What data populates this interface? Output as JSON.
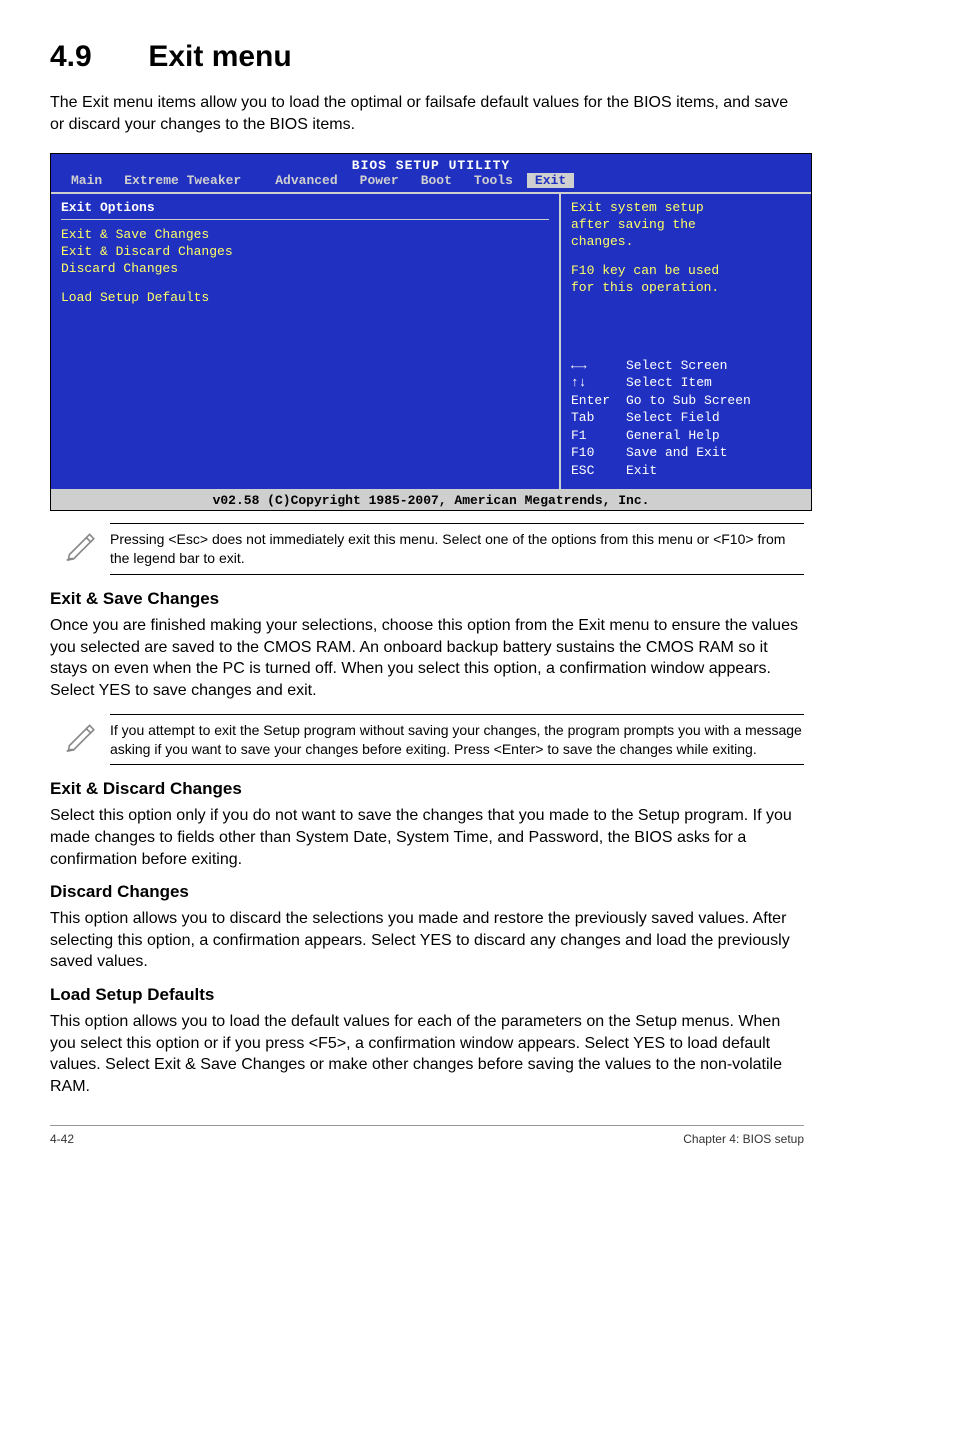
{
  "section": {
    "number": "4.9",
    "title": "Exit menu"
  },
  "intro": "The Exit menu items allow you to load the optimal or failsafe default values for the BIOS items, and save or discard your changes to the BIOS items.",
  "bios": {
    "title": "BIOS SETUP UTILITY",
    "tabs": {
      "main": "Main",
      "tweaker": "Extreme Tweaker",
      "advanced": "Advanced",
      "power": "Power",
      "boot": "Boot",
      "tools": "Tools",
      "exit": "Exit"
    },
    "left": {
      "header": "Exit Options",
      "items": {
        "save": "Exit & Save Changes",
        "discard_exit": "Exit & Discard Changes",
        "discard": "Discard Changes",
        "defaults": "Load Setup Defaults"
      }
    },
    "help": {
      "l1": "Exit system setup",
      "l2": "after saving the",
      "l3": "changes.",
      "l4": "F10 key can be used",
      "l5": "for this operation."
    },
    "keys": {
      "select_screen": {
        "k": "←→",
        "d": "Select Screen"
      },
      "select_item": {
        "k": "↑↓",
        "d": "Select Item"
      },
      "sub_screen": {
        "k": "Enter",
        "d": "Go to Sub Screen"
      },
      "select_field": {
        "k": "Tab",
        "d": "Select Field"
      },
      "general_help": {
        "k": "F1",
        "d": "General Help"
      },
      "save_exit": {
        "k": "F10",
        "d": "Save and Exit"
      },
      "esc_exit": {
        "k": "ESC",
        "d": "Exit"
      }
    },
    "footer": "v02.58 (C)Copyright 1985-2007, American Megatrends, Inc."
  },
  "note1": "Pressing <Esc> does not immediately exit this menu. Select one of the options from this menu or <F10> from the legend bar to exit.",
  "sections": {
    "save": {
      "h": "Exit & Save Changes",
      "p": "Once you are finished making your selections, choose this option from the Exit menu to ensure the values you selected are saved to the CMOS RAM. An onboard backup battery sustains the CMOS RAM so it stays on even when the PC is turned off. When you select this option, a confirmation window appears. Select YES to save changes and exit."
    },
    "note2": " If you attempt to exit the Setup program without saving your changes, the program prompts you with a message asking if you want to save your changes before exiting. Press <Enter>  to save the  changes while exiting.",
    "discard_exit": {
      "h": "Exit & Discard Changes",
      "p": "Select this option only if you do not want to save the changes that you  made to the Setup program. If you made changes to fields other than System Date, System Time, and Password, the BIOS asks for a confirmation before exiting."
    },
    "discard": {
      "h": "Discard Changes",
      "p": "This option allows you to discard the selections you made and restore the previously saved values. After selecting this option, a confirmation appears. Select YES to discard any changes and load the previously saved values."
    },
    "defaults": {
      "h": "Load Setup Defaults",
      "p": "This option allows you to load the default values for each of the parameters on the Setup menus. When you select this option or if you press <F5>, a confirmation window appears. Select YES to load default values. Select Exit & Save Changes or make other changes before saving the values to the non-volatile RAM."
    }
  },
  "footer": {
    "left": "4-42",
    "right": "Chapter 4: BIOS setup"
  }
}
